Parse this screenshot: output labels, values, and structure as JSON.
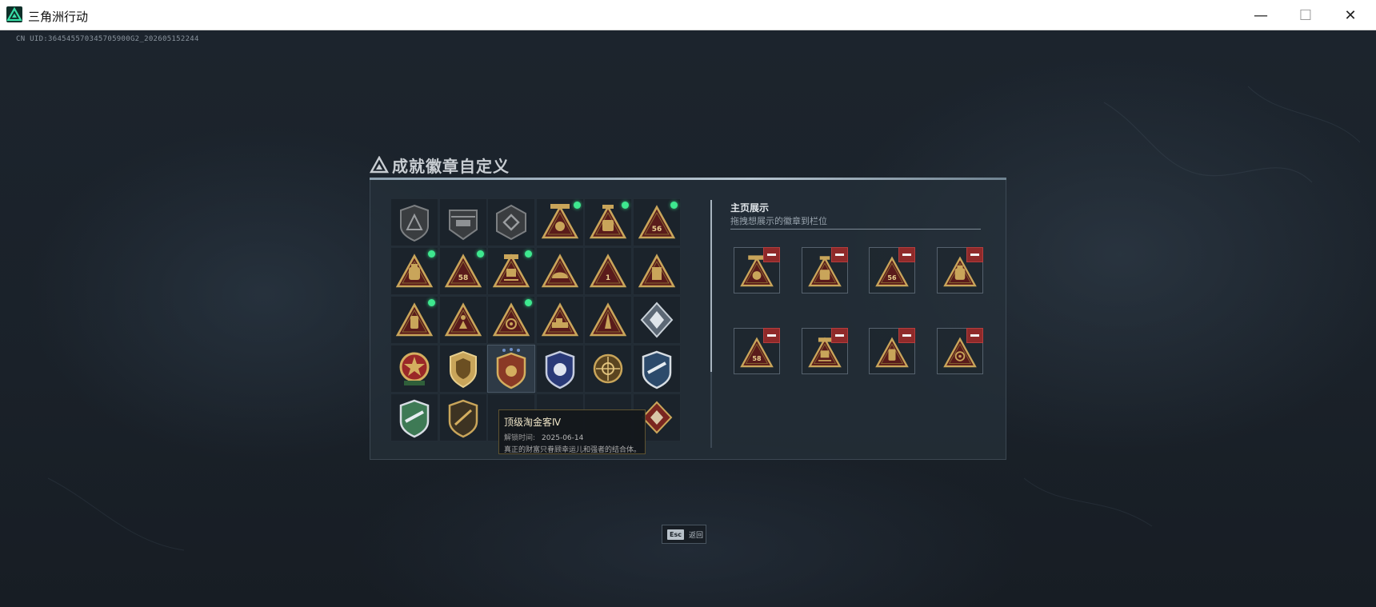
{
  "window": {
    "title": "三角洲行动",
    "minimize_symbol": "—",
    "maximize_symbol": "☐",
    "close_symbol": "✕"
  },
  "uid_text": "CN UID:364545570345705900G2_202605152244",
  "panel": {
    "title": "成就徽章自定义"
  },
  "colors": {
    "gold": "#c9a55a",
    "gold_dark": "#6b4f22",
    "triangle_red": "#5a1b1b",
    "new_dot": "#3ee88f",
    "remove_red": "#8f2a2a"
  },
  "badges": [
    {
      "icon": "gray-shield-triangle-icon",
      "new": false
    },
    {
      "icon": "gray-helicopter-badge-icon",
      "new": false
    },
    {
      "icon": "gray-hexagon-badge-icon",
      "new": false
    },
    {
      "icon": "gold-triangle-loot-icon",
      "new": true
    },
    {
      "icon": "gold-triangle-bag-icon",
      "new": true
    },
    {
      "icon": "gold-triangle-56-icon",
      "new": true
    },
    {
      "icon": "gold-triangle-backpack-icon",
      "new": true
    },
    {
      "icon": "gold-triangle-58-icon",
      "new": true
    },
    {
      "icon": "gold-triangle-robot-icon",
      "new": true
    },
    {
      "icon": "gold-triangle-helmet-icon",
      "new": false
    },
    {
      "icon": "gold-triangle-1-icon",
      "new": false
    },
    {
      "icon": "gold-triangle-case-icon",
      "new": false
    },
    {
      "icon": "gold-triangle-canister-icon",
      "new": true
    },
    {
      "icon": "gold-triangle-soldier-icon",
      "new": false
    },
    {
      "icon": "gold-triangle-emblem-icon",
      "new": true
    },
    {
      "icon": "gold-triangle-vehicle-icon",
      "new": false
    },
    {
      "icon": "gold-triangle-rocket-icon",
      "new": false
    },
    {
      "icon": "silver-cube-icon",
      "new": false
    },
    {
      "icon": "star-medal-icon",
      "new": false
    },
    {
      "icon": "gold-shield-medal-icon",
      "new": false
    },
    {
      "icon": "golden-looter-shield-icon",
      "new": false,
      "selected": true
    },
    {
      "icon": "blue-eagle-shield-icon",
      "new": false
    },
    {
      "icon": "gold-target-medal-icon",
      "new": false
    },
    {
      "icon": "blue-eagle-emblem-icon",
      "new": false
    },
    {
      "icon": "green-eagle-shield-icon",
      "new": false
    },
    {
      "icon": "gold-rifle-shield-icon",
      "new": false
    },
    {
      "icon": "empty-slot-icon",
      "new": false
    },
    {
      "icon": "empty-slot-icon",
      "new": false
    },
    {
      "icon": "empty-slot-icon",
      "new": false
    },
    {
      "icon": "red-wolf-emblem-icon",
      "new": false
    }
  ],
  "tooltip": {
    "title": "顶级淘金客Ⅳ",
    "unlock_label": "解锁时间:",
    "unlock_date": "2025-06-14",
    "description": "真正的财富只眷顾幸运儿和强者的结合体。"
  },
  "showcase": {
    "title": "主页展示",
    "subtitle": "拖拽想展示的徽章到栏位",
    "slots": [
      {
        "icon": "gold-triangle-loot-icon"
      },
      {
        "icon": "gold-triangle-bag-icon"
      },
      {
        "icon": "gold-triangle-56-icon"
      },
      {
        "icon": "gold-triangle-backpack-icon"
      },
      {
        "icon": "gold-triangle-58-icon"
      },
      {
        "icon": "gold-triangle-robot-icon"
      },
      {
        "icon": "gold-triangle-canister-icon"
      },
      {
        "icon": "gold-triangle-emblem-icon"
      }
    ]
  },
  "footer": {
    "esc_key": "Esc",
    "esc_label": "返回"
  }
}
